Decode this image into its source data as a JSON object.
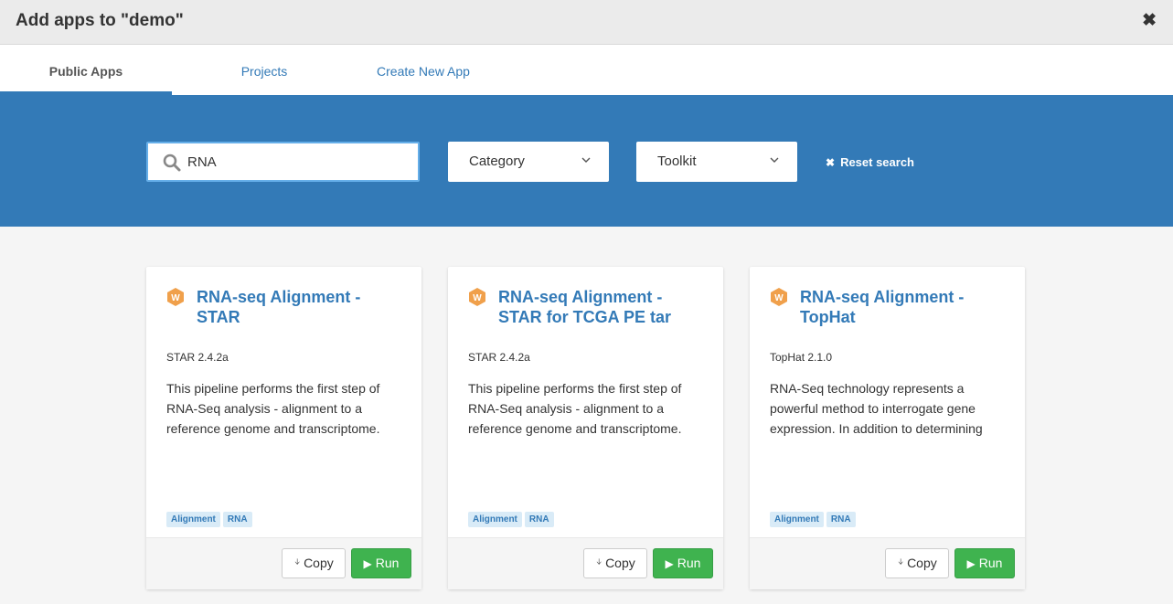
{
  "dialog": {
    "title": "Add apps to \"demo\"",
    "close_glyph": "✖"
  },
  "tabs": [
    {
      "label": "Public Apps",
      "active": true
    },
    {
      "label": "Projects",
      "active": false
    },
    {
      "label": "Create New App",
      "active": false
    }
  ],
  "search": {
    "value": "RNA",
    "icon": "search-icon"
  },
  "filters": {
    "category": "Category",
    "toolkit": "Toolkit",
    "reset_label": "Reset search",
    "reset_glyph": "✖"
  },
  "apps": [
    {
      "title": "RNA-seq Alignment - STAR",
      "version": "STAR 2.4.2a",
      "description": "This pipeline performs the first step of RNA-Seq analysis - alignment to a reference genome and transcriptome.",
      "tags": [
        "Alignment",
        "RNA"
      ],
      "copy_label": "Copy",
      "run_label": "Run"
    },
    {
      "title": "RNA-seq Alignment - STAR for TCGA PE tar",
      "version": "STAR 2.4.2a",
      "description": "This pipeline performs the first step of RNA-Seq analysis - alignment to a reference genome and transcriptome.",
      "tags": [
        "Alignment",
        "RNA"
      ],
      "copy_label": "Copy",
      "run_label": "Run"
    },
    {
      "title": "RNA-seq Alignment - TopHat",
      "version": "TopHat 2.1.0",
      "description": "RNA-Seq technology represents a powerful method to interrogate gene expression. In addition to determining",
      "tags": [
        "Alignment",
        "RNA"
      ],
      "copy_label": "Copy",
      "run_label": "Run"
    }
  ],
  "colors": {
    "brand_blue": "#337ab7",
    "run_green": "#3fb34f",
    "workflow_orange": "#f0a04b"
  }
}
